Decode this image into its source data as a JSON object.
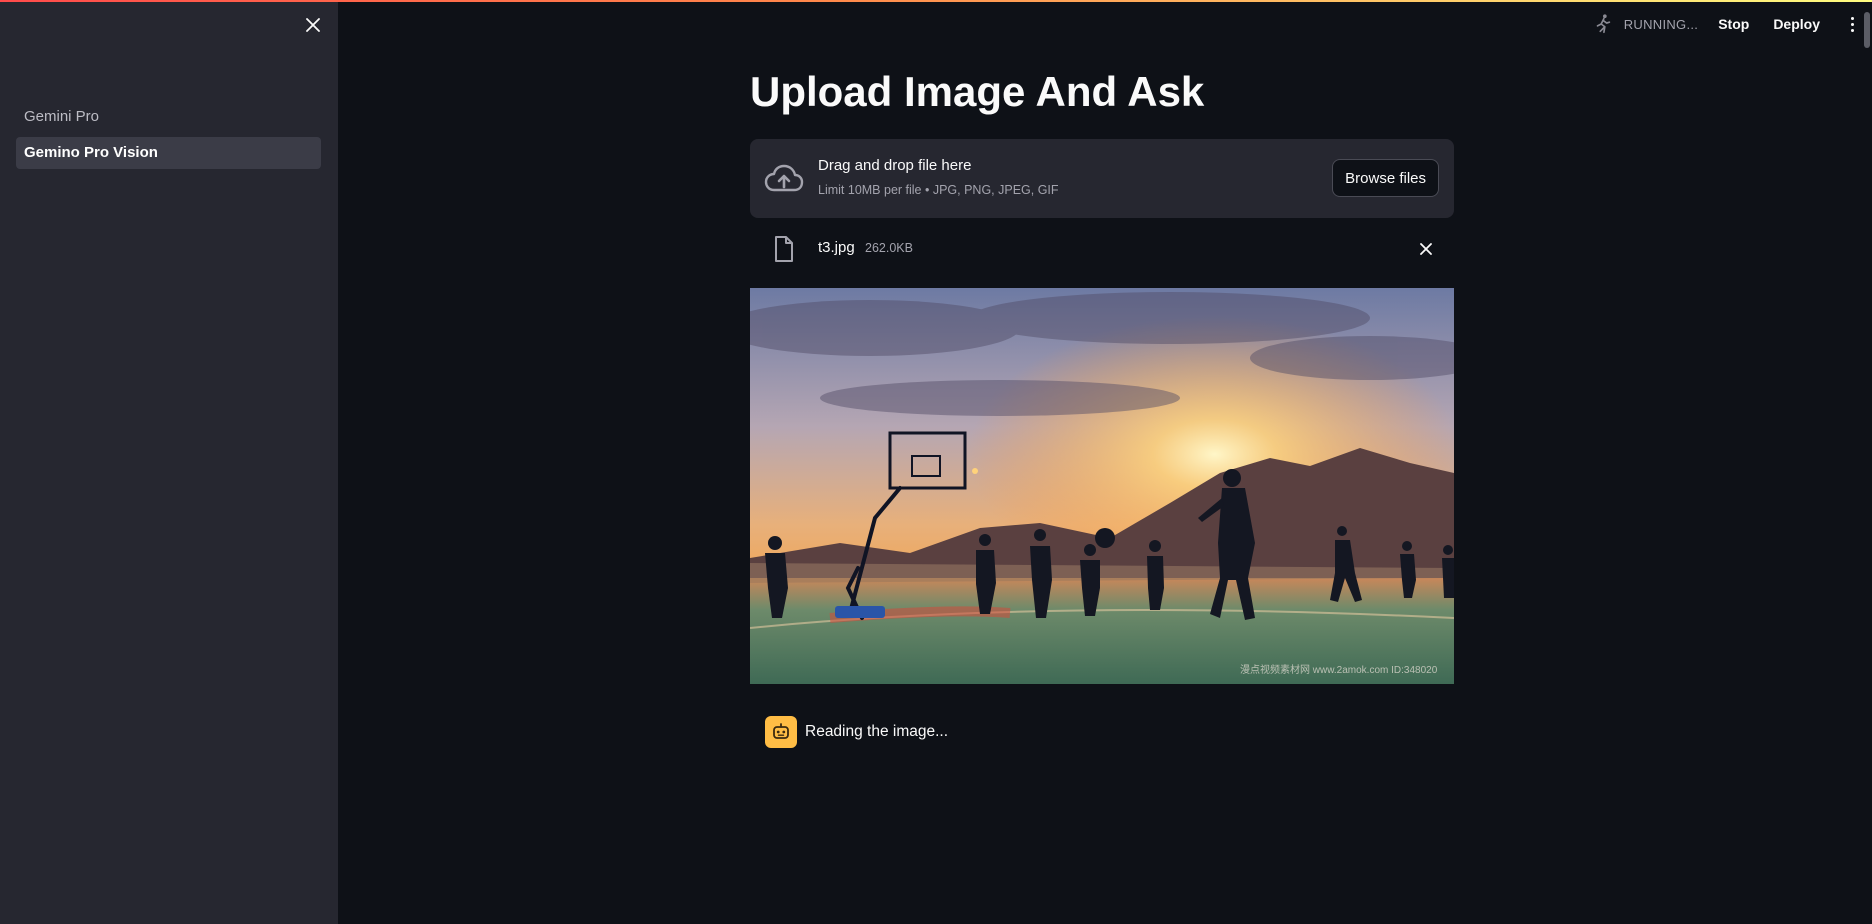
{
  "sidebar": {
    "items": [
      {
        "label": "Gemini Pro",
        "active": false
      },
      {
        "label": "Gemino Pro Vision",
        "active": true
      }
    ]
  },
  "header": {
    "status": "RUNNING...",
    "stop_label": "Stop",
    "deploy_label": "Deploy"
  },
  "main": {
    "title": "Upload Image And Ask",
    "uploader": {
      "title": "Drag and drop file here",
      "subtitle": "Limit 10MB per file • JPG, PNG, JPEG, GIF",
      "browse_label": "Browse files"
    },
    "file": {
      "name": "t3.jpg",
      "size": "262.0KB"
    },
    "image": {
      "watermark": "漫点视频素材网 www.2amok.com  ID:348020"
    },
    "chat": {
      "message": "Reading the image..."
    }
  },
  "colors": {
    "accent_gradient_start": "#ff4b4b",
    "accent_gradient_end": "#fffd80",
    "bot_avatar": "#ffbd45",
    "background": "#0e1117",
    "sidebar": "#262730"
  }
}
